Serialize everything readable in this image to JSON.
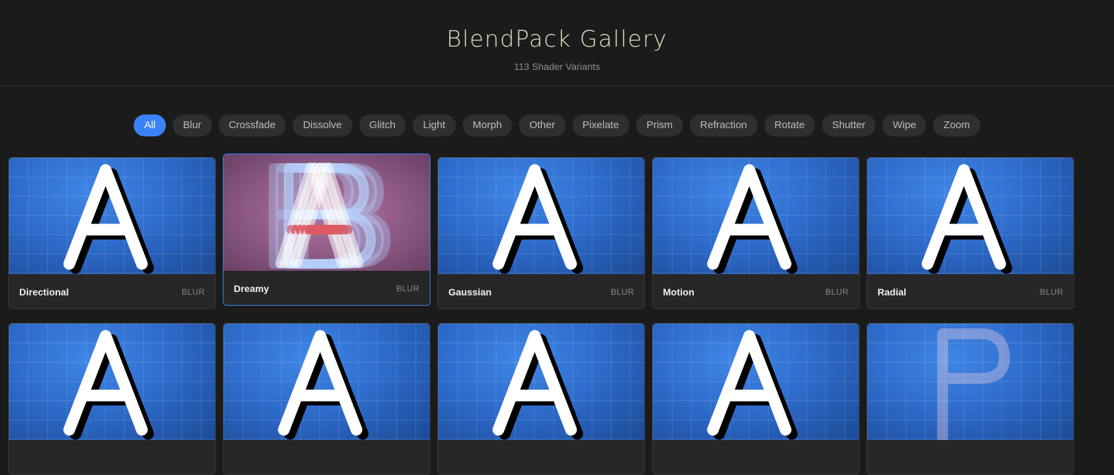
{
  "header": {
    "title": "BlendPack Gallery",
    "subtitle": "113 Shader Variants"
  },
  "filters": [
    "All",
    "Blur",
    "Crossfade",
    "Dissolve",
    "Glitch",
    "Light",
    "Morph",
    "Other",
    "Pixelate",
    "Prism",
    "Refraction",
    "Rotate",
    "Shutter",
    "Wipe",
    "Zoom"
  ],
  "active_filter": "All",
  "cards": [
    {
      "name": "Directional",
      "category": "BLUR",
      "preview": "letter-A"
    },
    {
      "name": "Dreamy",
      "category": "BLUR",
      "preview": "letter-A-B-blend",
      "hovered": true
    },
    {
      "name": "Gaussian",
      "category": "BLUR",
      "preview": "letter-A"
    },
    {
      "name": "Motion",
      "category": "BLUR",
      "preview": "letter-A"
    },
    {
      "name": "Radial",
      "category": "BLUR",
      "preview": "letter-A"
    },
    {
      "name": "",
      "category": "",
      "preview": "letter-A"
    },
    {
      "name": "",
      "category": "",
      "preview": "letter-A"
    },
    {
      "name": "",
      "category": "",
      "preview": "letter-A"
    },
    {
      "name": "",
      "category": "",
      "preview": "letter-A"
    },
    {
      "name": "",
      "category": "",
      "preview": "letter-B-faded"
    }
  ],
  "colors": {
    "background": "#1b1b1b",
    "accent": "#3b82f6",
    "title": "#e9ddc2"
  }
}
